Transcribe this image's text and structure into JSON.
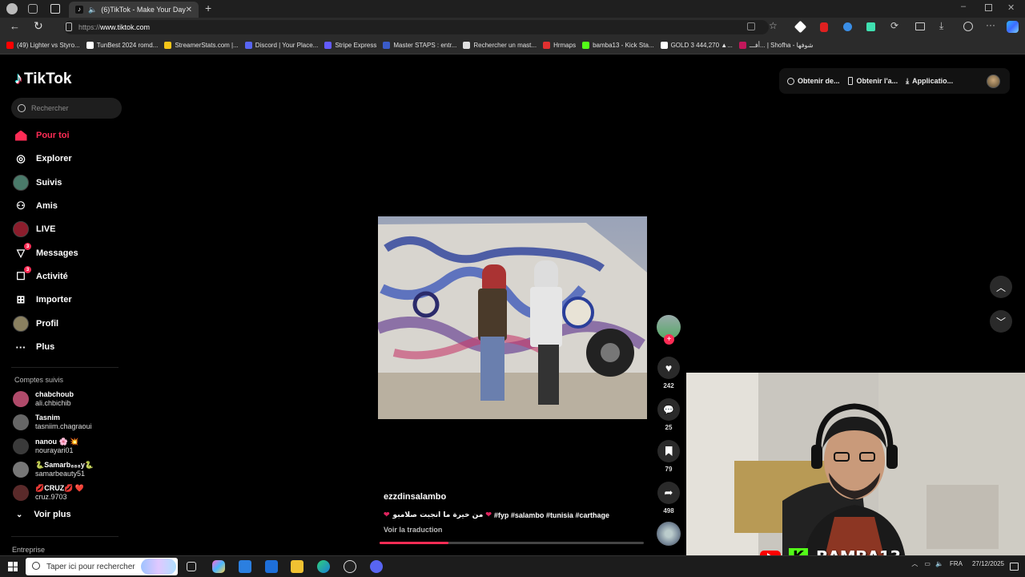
{
  "browser": {
    "tab_title": "(6)TikTok - Make Your Day",
    "url_prefix": "https://",
    "url_host": "www.tiktok.com",
    "bookmarks": [
      {
        "label": "(49) Lighter vs Styro...",
        "color": "#ff0000"
      },
      {
        "label": "TunBest 2024 romd...",
        "color": "#ffffff"
      },
      {
        "label": "StreamerStats.com |...",
        "color": "#f5c518"
      },
      {
        "label": "Discord | Your Place...",
        "color": "#5865f2"
      },
      {
        "label": "Stripe Express",
        "color": "#635bff"
      },
      {
        "label": "Master STAPS : entr...",
        "color": "#3a5bc7"
      },
      {
        "label": "Rechercher un mast...",
        "color": "#e0e0e0"
      },
      {
        "label": "Hrmaps",
        "color": "#e03030"
      },
      {
        "label": "bamba13 - Kick Sta...",
        "color": "#53fc18"
      },
      {
        "label": "GOLD 3 444,270 ▲...",
        "color": "#ffffff"
      },
      {
        "label": "أفـــ... | Shofha - شوفها",
        "color": "#c2185b"
      }
    ]
  },
  "tiktok": {
    "logo": "TikTok",
    "search_placeholder": "Rechercher",
    "nav": [
      {
        "label": "Pour toi",
        "icon": "home-icon"
      },
      {
        "label": "Explorer",
        "icon": "compass-icon"
      },
      {
        "label": "Suivis",
        "icon": "following-icon"
      },
      {
        "label": "Amis",
        "icon": "friends-icon"
      },
      {
        "label": "LIVE",
        "icon": "live-icon"
      },
      {
        "label": "Messages",
        "icon": "messages-icon",
        "badge": "3"
      },
      {
        "label": "Activité",
        "icon": "activity-icon",
        "badge": "3"
      },
      {
        "label": "Importer",
        "icon": "upload-icon"
      },
      {
        "label": "Profil",
        "icon": "profile-icon"
      },
      {
        "label": "Plus",
        "icon": "more-icon"
      }
    ],
    "followed_heading": "Comptes suivis",
    "followed": [
      {
        "name": "chabchoub",
        "user": "ali.chbichib"
      },
      {
        "name": "Tasnim",
        "user": "tasniim.chagraoui"
      },
      {
        "name": "nanou 🌸 💥",
        "user": "nourayari01"
      },
      {
        "name": "🐍Samarb₈₈₈y🐍",
        "user": "samarbeauty51"
      },
      {
        "name": "💋CRUZ💋 ❤️",
        "user": "cruz.9703"
      }
    ],
    "see_more": "Voir plus",
    "enterprise": "Entreprise",
    "top_buttons": [
      "Obtenir de...",
      "Obtenir l'a...",
      "Applicatio..."
    ],
    "video": {
      "author": "ezzdinsalambo",
      "caption_arabic": "من خيرة ما انجبت صلامبو",
      "caption_tags": "#fyp #salambo #tunisia #carthage",
      "translate": "Voir la traduction",
      "progress": 0.26,
      "likes": "242",
      "comments": "25",
      "saves": "79",
      "shares": "498"
    }
  },
  "overlay": {
    "streamer": "BAMBA13"
  },
  "taskbar": {
    "search_placeholder": "Taper ici pour rechercher",
    "lang": "FRA",
    "date": "27/12/2025"
  }
}
